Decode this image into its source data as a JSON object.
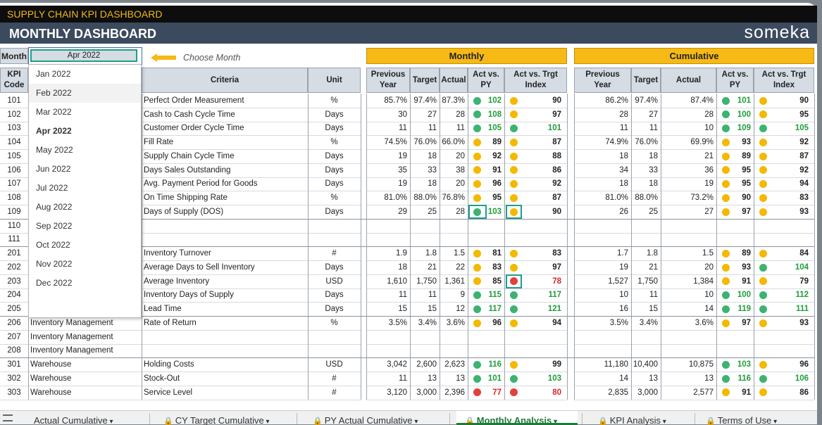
{
  "app_title": "SUPPLY CHAIN KPI DASHBOARD",
  "header": {
    "title": "MONTHLY DASHBOARD",
    "logo": "someka"
  },
  "month_selector": {
    "label": "Month",
    "value": "Apr 2022",
    "hint": "Choose Month"
  },
  "sections": {
    "monthly": "Monthly",
    "cumulative": "Cumulative"
  },
  "columns": {
    "kpi_code": "KPI Code",
    "criteria": "Criteria",
    "unit": "Unit",
    "prev_year": "Previous Year",
    "target": "Target",
    "actual": "Actual",
    "act_vs_py": "Act vs. PY",
    "act_vs_trgt": "Act vs. Trgt Index"
  },
  "dropdown_options": [
    "Jan 2022",
    "Feb 2022",
    "Mar 2022",
    "Apr 2022",
    "May 2022",
    "Jun 2022",
    "Jul 2022",
    "Aug 2022",
    "Sep 2022",
    "Oct 2022",
    "Nov 2022",
    "Dec 2022"
  ],
  "status_colors": {
    "green": "#3cb371",
    "yellow": "#f5b800",
    "red": "#e0413c"
  },
  "rows": [
    {
      "code": "101",
      "group": "",
      "criteria": "Perfect Order Measurement",
      "unit": "%",
      "m": [
        "85.7%",
        "97.4%",
        "87.3%",
        "green",
        "102",
        "yellow",
        "90"
      ],
      "c": [
        "86.2%",
        "97.4%",
        "87.4%",
        "green",
        "101",
        "yellow",
        "90"
      ]
    },
    {
      "code": "102",
      "group": "",
      "criteria": "Cash to Cash Cycle Time",
      "unit": "Days",
      "m": [
        "30",
        "27",
        "28",
        "green",
        "108",
        "yellow",
        "97"
      ],
      "c": [
        "28",
        "27",
        "28",
        "green",
        "100",
        "yellow",
        "95"
      ]
    },
    {
      "code": "103",
      "group": "",
      "criteria": "Customer Order Cycle Time",
      "unit": "Days",
      "m": [
        "11",
        "11",
        "11",
        "green",
        "105",
        "green",
        "101"
      ],
      "c": [
        "11",
        "11",
        "10",
        "green",
        "109",
        "green",
        "105"
      ]
    },
    {
      "code": "104",
      "group": "",
      "criteria": "Fill Rate",
      "unit": "%",
      "m": [
        "74.5%",
        "76.0%",
        "66.0%",
        "yellow",
        "89",
        "yellow",
        "87"
      ],
      "c": [
        "74.9%",
        "76.0%",
        "69.9%",
        "yellow",
        "93",
        "yellow",
        "92"
      ]
    },
    {
      "code": "105",
      "group": "",
      "criteria": "Supply Chain Cycle Time",
      "unit": "Days",
      "m": [
        "19",
        "18",
        "20",
        "yellow",
        "92",
        "yellow",
        "88"
      ],
      "c": [
        "18",
        "18",
        "21",
        "yellow",
        "89",
        "yellow",
        "87"
      ]
    },
    {
      "code": "106",
      "group": "",
      "criteria": "Days Sales Outstanding",
      "unit": "Days",
      "m": [
        "35",
        "33",
        "38",
        "yellow",
        "91",
        "yellow",
        "86"
      ],
      "c": [
        "34",
        "33",
        "36",
        "yellow",
        "95",
        "yellow",
        "92"
      ]
    },
    {
      "code": "107",
      "group": "",
      "criteria": "Avg. Payment Period for Goods",
      "unit": "Days",
      "m": [
        "19",
        "18",
        "20",
        "yellow",
        "96",
        "yellow",
        "92"
      ],
      "c": [
        "18",
        "18",
        "19",
        "yellow",
        "95",
        "yellow",
        "94"
      ]
    },
    {
      "code": "108",
      "group": "",
      "criteria": "On Time Shipping Rate",
      "unit": "%",
      "m": [
        "81.0%",
        "88.0%",
        "76.8%",
        "yellow",
        "95",
        "yellow",
        "87"
      ],
      "c": [
        "81.0%",
        "88.0%",
        "73.2%",
        "yellow",
        "90",
        "yellow",
        "83"
      ]
    },
    {
      "code": "109",
      "group": "",
      "criteria": "Days of Supply (DOS)",
      "unit": "Days",
      "m": [
        "29",
        "25",
        "28",
        "green",
        "103",
        "yellow",
        "90"
      ],
      "c": [
        "26",
        "25",
        "27",
        "yellow",
        "97",
        "yellow",
        "93"
      ]
    },
    {
      "code": "110",
      "group": "",
      "criteria": "",
      "unit": "",
      "m": [
        "",
        "",
        "",
        "",
        "",
        "",
        ""
      ],
      "c": [
        "",
        "",
        "",
        "",
        "",
        "",
        ""
      ]
    },
    {
      "code": "111",
      "group": "",
      "criteria": "",
      "unit": "",
      "m": [
        "",
        "",
        "",
        "",
        "",
        "",
        ""
      ],
      "c": [
        "",
        "",
        "",
        "",
        "",
        "",
        ""
      ]
    },
    {
      "code": "201",
      "group": "",
      "criteria": "Inventory Turnover",
      "unit": "#",
      "m": [
        "1.9",
        "1.8",
        "1.5",
        "yellow",
        "81",
        "yellow",
        "83"
      ],
      "c": [
        "1.7",
        "1.8",
        "1.5",
        "yellow",
        "89",
        "yellow",
        "84"
      ]
    },
    {
      "code": "202",
      "group": "",
      "criteria": "Average Days to Sell Inventory",
      "unit": "Days",
      "m": [
        "18",
        "21",
        "22",
        "yellow",
        "83",
        "yellow",
        "97"
      ],
      "c": [
        "19",
        "21",
        "20",
        "yellow",
        "93",
        "green",
        "104"
      ]
    },
    {
      "code": "203",
      "group": "",
      "criteria": "Average Inventory",
      "unit": "USD",
      "m": [
        "1,610",
        "1,750",
        "1,361",
        "yellow",
        "85",
        "red",
        "78"
      ],
      "c": [
        "1,527",
        "1,750",
        "1,384",
        "yellow",
        "91",
        "yellow",
        "79"
      ]
    },
    {
      "code": "204",
      "group": "",
      "criteria": "Inventory Days of Supply",
      "unit": "Days",
      "m": [
        "11",
        "11",
        "9",
        "green",
        "115",
        "green",
        "117"
      ],
      "c": [
        "10",
        "11",
        "10",
        "green",
        "100",
        "green",
        "112"
      ]
    },
    {
      "code": "205",
      "group": "",
      "criteria": "Lead Time",
      "unit": "Days",
      "m": [
        "15",
        "15",
        "12",
        "green",
        "117",
        "green",
        "121"
      ],
      "c": [
        "16",
        "15",
        "14",
        "green",
        "119",
        "green",
        "111"
      ]
    },
    {
      "code": "206",
      "group": "Inventory Management",
      "criteria": "Rate of Return",
      "unit": "%",
      "m": [
        "3.5%",
        "3.4%",
        "3.6%",
        "yellow",
        "96",
        "yellow",
        "94"
      ],
      "c": [
        "3.5%",
        "3.4%",
        "3.6%",
        "yellow",
        "97",
        "yellow",
        "93"
      ]
    },
    {
      "code": "207",
      "group": "Inventory Management",
      "criteria": "",
      "unit": "",
      "m": [
        "",
        "",
        "",
        "",
        "",
        "",
        ""
      ],
      "c": [
        "",
        "",
        "",
        "",
        "",
        "",
        ""
      ]
    },
    {
      "code": "208",
      "group": "Inventory Management",
      "criteria": "",
      "unit": "",
      "m": [
        "",
        "",
        "",
        "",
        "",
        "",
        ""
      ],
      "c": [
        "",
        "",
        "",
        "",
        "",
        "",
        ""
      ]
    },
    {
      "code": "301",
      "group": "Warehouse",
      "criteria": "Holding Costs",
      "unit": "USD",
      "m": [
        "3,042",
        "2,600",
        "2,623",
        "green",
        "116",
        "yellow",
        "99"
      ],
      "c": [
        "11,180",
        "10,400",
        "10,875",
        "green",
        "103",
        "yellow",
        "96"
      ]
    },
    {
      "code": "302",
      "group": "Warehouse",
      "criteria": "Stock-Out",
      "unit": "#",
      "m": [
        "11",
        "13",
        "13",
        "green",
        "101",
        "green",
        "103"
      ],
      "c": [
        "14",
        "13",
        "13",
        "green",
        "116",
        "green",
        "106"
      ]
    },
    {
      "code": "303",
      "group": "Warehouse",
      "criteria": "Service Level",
      "unit": "#",
      "m": [
        "3,120",
        "3,000",
        "2,396",
        "red",
        "77",
        "red",
        "80"
      ],
      "c": [
        "2,835",
        "3,000",
        "2,577",
        "yellow",
        "91",
        "yellow",
        "86"
      ]
    }
  ],
  "tabs": [
    "Actual Cumulative",
    "CY Target Cumulative",
    "PY Actual Cumulative",
    "Monthly Analysis",
    "KPI Analysis",
    "Terms of Use"
  ],
  "active_tab": "Monthly Analysis"
}
